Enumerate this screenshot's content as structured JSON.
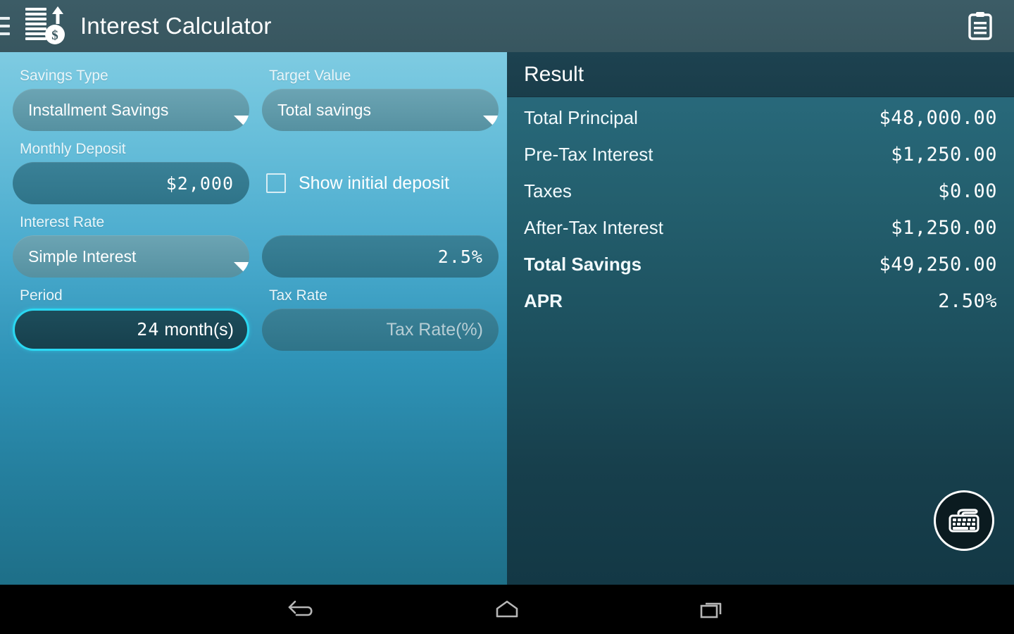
{
  "appbar": {
    "menu_icon": "hamburger-menu-icon",
    "app_icon": "coins-dollar-growth-icon",
    "title": "Interest Calculator",
    "action_icon": "clipboard-icon"
  },
  "form": {
    "savings_type": {
      "label": "Savings Type",
      "value": "Installment Savings"
    },
    "target_value": {
      "label": "Target Value",
      "value": "Total savings"
    },
    "monthly_deposit": {
      "label": "Monthly Deposit",
      "value": "$2,000"
    },
    "show_initial_deposit": {
      "label": "Show initial deposit",
      "checked": "false"
    },
    "interest_rate": {
      "label": "Interest Rate",
      "type_value": "Simple Interest",
      "rate_value": "2.5%"
    },
    "period": {
      "label": "Period",
      "number": "24",
      "unit": " month(s)",
      "focused": "true"
    },
    "tax_rate": {
      "label": "Tax Rate",
      "placeholder": "Tax Rate(%)",
      "value": ""
    }
  },
  "result": {
    "title": "Result",
    "rows": [
      {
        "label": "Total Principal",
        "value": "$48,000.00",
        "bold": "false"
      },
      {
        "label": "Pre-Tax Interest",
        "value": "$1,250.00",
        "bold": "false"
      },
      {
        "label": "Taxes",
        "value": "$0.00",
        "bold": "false"
      },
      {
        "label": "After-Tax Interest",
        "value": "$1,250.00",
        "bold": "false"
      },
      {
        "label": "Total Savings",
        "value": "$49,250.00",
        "bold": "true"
      },
      {
        "label": "APR",
        "value": "2.50%",
        "bold": "true"
      }
    ]
  },
  "fab": {
    "icon": "keyboard-icon"
  },
  "navbar": {
    "back": "back-icon",
    "home": "home-icon",
    "recents": "recents-icon"
  },
  "colors": {
    "appbar": "#3a575f",
    "left_panel_top": "#7ecbe2",
    "left_panel_bottom": "#1e6f88",
    "right_panel_top": "#2a6d80",
    "right_panel_bottom": "#133845",
    "field_fill": "#5b97a8",
    "focus_accent": "#2ad8f2",
    "result_header": "#1d4250"
  }
}
